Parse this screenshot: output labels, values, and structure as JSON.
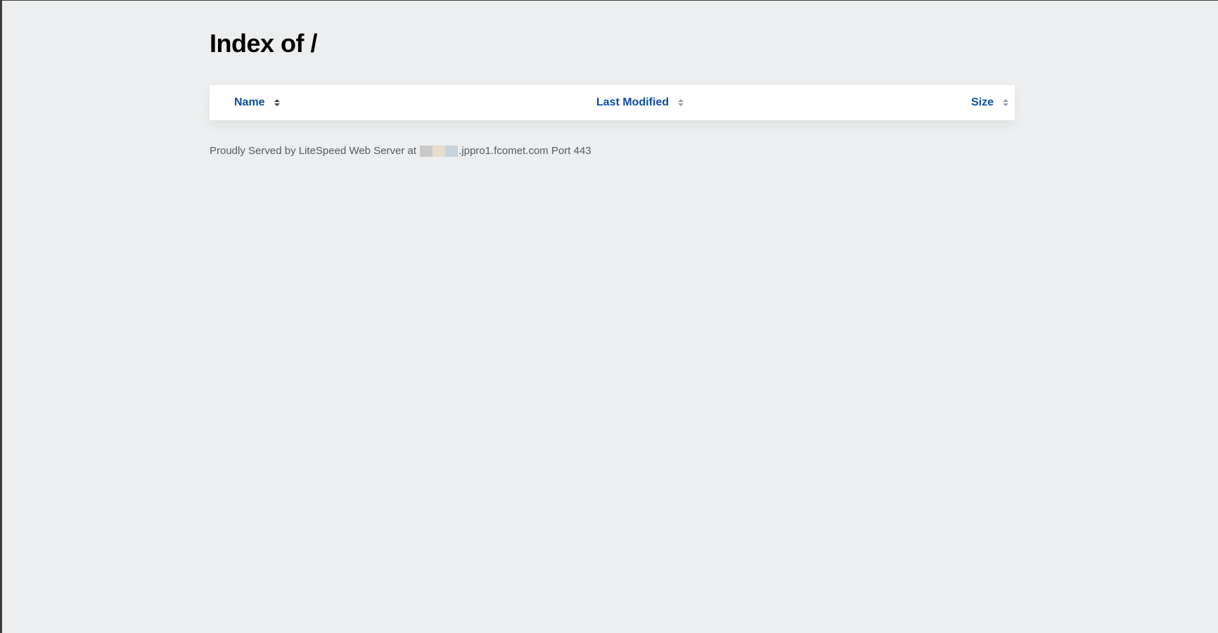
{
  "page": {
    "title": "Index of /"
  },
  "table": {
    "columns": [
      {
        "label": "Name",
        "sort_active": true
      },
      {
        "label": "Last Modified",
        "sort_active": false
      },
      {
        "label": "Size",
        "sort_active": false
      }
    ],
    "rows": []
  },
  "footer": {
    "prefix": "Proudly Served by LiteSpeed Web Server at",
    "host_visible": ".jppro1.fcomet.com",
    "port_text": "Port 443",
    "redacted_colors": [
      "#c9c9c9",
      "#e8dccb",
      "#c7d3dc"
    ]
  },
  "colors": {
    "link": "#0e4ea1",
    "background": "#eceeef",
    "panel": "#ffffff"
  }
}
